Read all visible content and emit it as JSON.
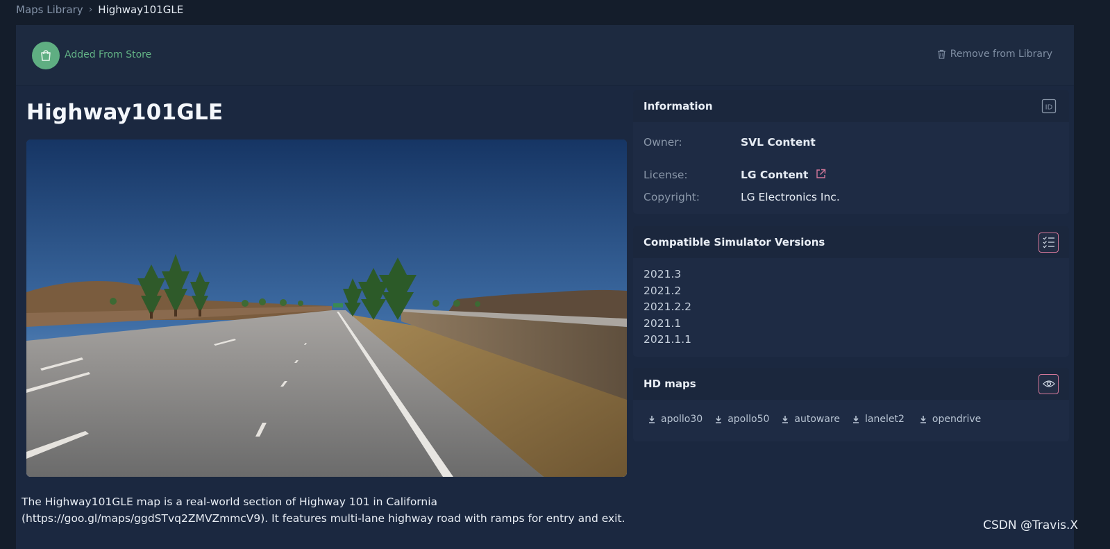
{
  "breadcrumb": {
    "parent": "Maps Library",
    "separator": "›",
    "current": "Highway101GLE"
  },
  "store": {
    "badge_icon": "shopping-bag-icon",
    "label": "Added From Store",
    "remove_icon": "trash-icon",
    "remove_label": "Remove from Library"
  },
  "map": {
    "title": "Highway101GLE",
    "description_line1": "The Highway101GLE map is a real-world section of Highway 101 in California",
    "description_line2": "(https://goo.gl/maps/ggdSTvq2ZMVZmmcV9). It features multi-lane highway road with ramps for entry and exit."
  },
  "information": {
    "header": "Information",
    "id_icon": "id-icon",
    "id_label": "ID",
    "owner_label": "Owner:",
    "owner_value": "SVL Content",
    "license_label": "License:",
    "license_value": "LG Content",
    "license_icon": "external-link-icon",
    "copyright_label": "Copyright:",
    "copyright_value": "LG Electronics Inc."
  },
  "compat": {
    "header": "Compatible Simulator Versions",
    "icon": "checklist-icon",
    "versions": [
      "2021.3",
      "2021.2",
      "2021.2.2",
      "2021.1",
      "2021.1.1"
    ]
  },
  "hdmaps": {
    "header": "HD maps",
    "icon": "eye-icon",
    "links": [
      "apollo30",
      "apollo50",
      "autoware",
      "lanelet2",
      "opendrive"
    ],
    "link_icon": "download-icon"
  },
  "watermark": "CSDN @Travis.X",
  "colors": {
    "background": "#141d2b",
    "panel": "#1b2840",
    "accent_green": "#5fae82",
    "accent_pink": "#d4789a"
  }
}
